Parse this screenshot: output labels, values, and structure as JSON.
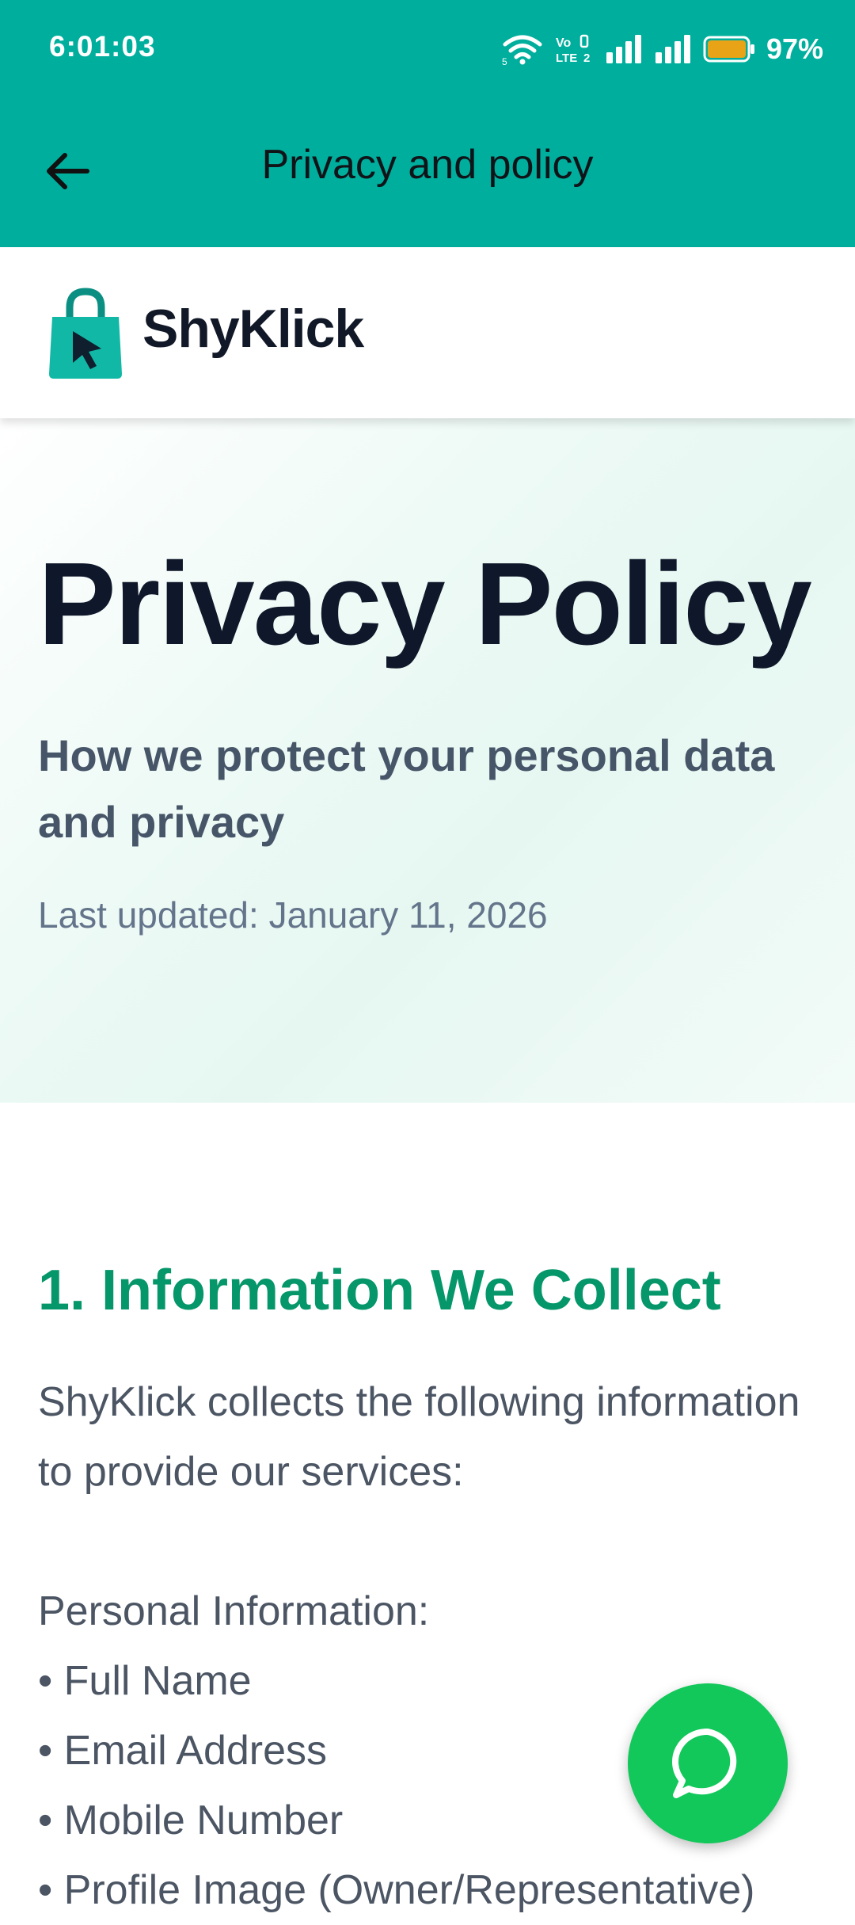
{
  "status_bar": {
    "time": "6:01:03",
    "battery_percent": "97%",
    "battery_level": 0.97,
    "icons": [
      "wifi-icon",
      "volte-icon",
      "signal-1-icon",
      "signal-2-icon",
      "battery-icon"
    ]
  },
  "app_bar": {
    "title": "Privacy and policy",
    "back_icon": "arrow-left-icon",
    "background_color": "#00AE9D"
  },
  "brand": {
    "name": "ShyKlick",
    "logo_icon": "shopping-bag-cursor-icon"
  },
  "hero": {
    "title": "Privacy Policy",
    "subtitle": "How we protect your personal data and privacy",
    "updated": "Last updated: January 11, 2026"
  },
  "section": {
    "title": "1. Information We Collect",
    "intro": "ShyKlick collects the following information to provide our services:",
    "list_heading": "Personal Information:",
    "items": [
      "• Full Name",
      "• Email Address",
      "• Mobile Number",
      "• Profile Image (Owner/Representative)"
    ],
    "accent_color": "#059669"
  },
  "fab": {
    "icon": "chat-bubble-icon",
    "color": "#12C85A"
  }
}
